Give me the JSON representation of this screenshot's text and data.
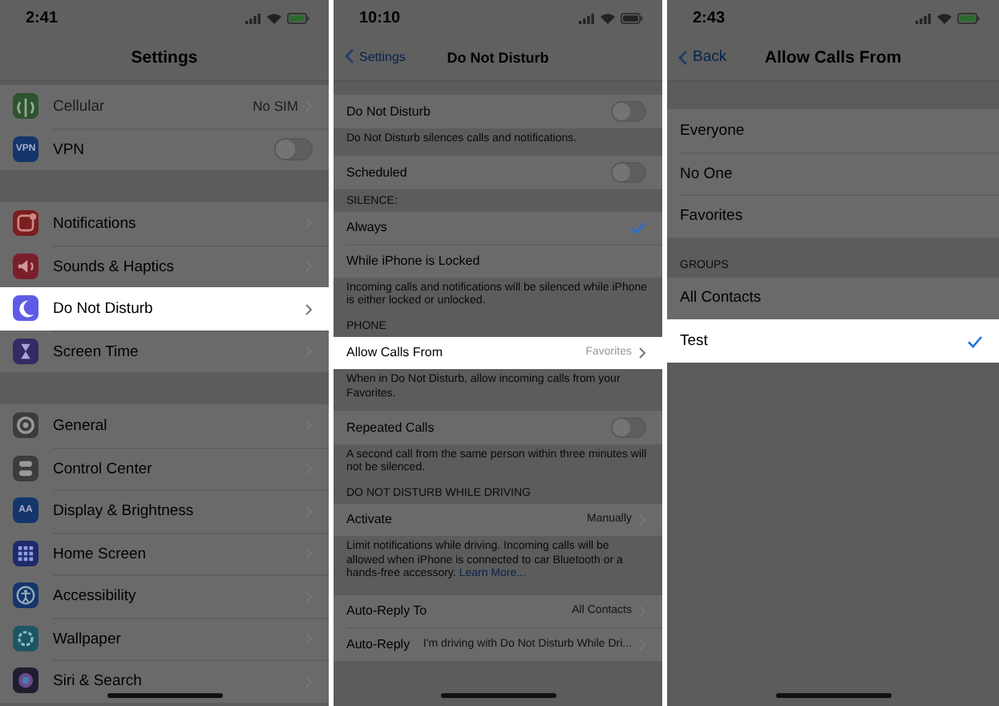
{
  "panels": [
    {
      "status": {
        "time": "2:41"
      },
      "nav": {
        "title": "Settings"
      },
      "sections": [
        {
          "rows": [
            {
              "label": "Cellular",
              "value": "No SIM",
              "chevron": true,
              "disabled": true,
              "selected": false,
              "icon": {
                "kind": "antenna",
                "color": "#2f5230"
              }
            },
            {
              "label": "VPN",
              "toggle": {
                "on": false
              },
              "disabled": false,
              "selected": false,
              "icon": {
                "kind": "text",
                "text": "VPN",
                "color": "#14366b"
              }
            }
          ]
        },
        {
          "rows": [
            {
              "label": "Notifications",
              "chevron": true,
              "disabled": false,
              "selected": false,
              "icon": {
                "kind": "bell",
                "color": "#7a1e1e"
              }
            },
            {
              "label": "Sounds & Haptics",
              "chevron": true,
              "disabled": false,
              "selected": false,
              "icon": {
                "kind": "speaker",
                "color": "#7a1e2a"
              }
            },
            {
              "label": "Do Not Disturb",
              "chevron": true,
              "disabled": false,
              "selected": true,
              "icon": {
                "kind": "moon",
                "color": "#5e5ce6"
              }
            },
            {
              "label": "Screen Time",
              "chevron": true,
              "disabled": false,
              "selected": false,
              "icon": {
                "kind": "hourglass",
                "color": "#332a66"
              }
            }
          ]
        },
        {
          "rows": [
            {
              "label": "General",
              "chevron": true,
              "disabled": false,
              "selected": false,
              "icon": {
                "kind": "gear",
                "color": "#3c3c3c"
              }
            },
            {
              "label": "Control Center",
              "chevron": true,
              "disabled": false,
              "selected": false,
              "icon": {
                "kind": "switches",
                "color": "#3c3c3c"
              }
            },
            {
              "label": "Display & Brightness",
              "chevron": true,
              "disabled": false,
              "selected": false,
              "icon": {
                "kind": "text",
                "text": "AA",
                "color": "#14366b"
              }
            },
            {
              "label": "Home Screen",
              "chevron": true,
              "disabled": false,
              "selected": false,
              "icon": {
                "kind": "grid",
                "color": "#1e2a6b"
              }
            },
            {
              "label": "Accessibility",
              "chevron": true,
              "disabled": false,
              "selected": false,
              "icon": {
                "kind": "person",
                "color": "#14366b"
              }
            },
            {
              "label": "Wallpaper",
              "chevron": true,
              "disabled": false,
              "selected": false,
              "icon": {
                "kind": "flower",
                "color": "#1e5563"
              }
            },
            {
              "label": "Siri & Search",
              "chevron": true,
              "disabled": false,
              "selected": false,
              "icon": {
                "kind": "orb",
                "color": "#1e1e2e"
              }
            }
          ]
        }
      ]
    },
    {
      "status": {
        "time": "10:10"
      },
      "nav": {
        "back": "Settings",
        "title": "Do Not Disturb"
      },
      "sections": [
        {
          "rows": [
            {
              "label": "Do Not Disturb",
              "toggle": {
                "on": false
              },
              "selected": false
            }
          ],
          "footer": "Do Not Disturb silences calls and notifications."
        },
        {
          "rows": [
            {
              "label": "Scheduled",
              "toggle": {
                "on": false
              },
              "selected": false
            }
          ]
        },
        {
          "header": "SILENCE:",
          "rows": [
            {
              "label": "Always",
              "checked": true,
              "selected": false
            },
            {
              "label": "While iPhone is Locked",
              "checked": false,
              "selected": false
            }
          ],
          "footer": "Incoming calls and notifications will be silenced while iPhone is either locked or unlocked."
        },
        {
          "header": "PHONE",
          "rows": [
            {
              "label": "Allow Calls From",
              "value": "Favorites",
              "chevron": true,
              "selected": true
            }
          ],
          "footer": "When in Do Not Disturb, allow incoming calls from your Favorites."
        },
        {
          "rows": [
            {
              "label": "Repeated Calls",
              "toggle": {
                "on": false
              },
              "selected": false
            }
          ],
          "footer": "A second call from the same person within three minutes will not be silenced."
        },
        {
          "header": "DO NOT DISTURB WHILE DRIVING",
          "rows": [
            {
              "label": "Activate",
              "value": "Manually",
              "chevron": true,
              "selected": false
            }
          ],
          "footer": "Limit notifications while driving. Incoming calls will be allowed when iPhone is connected to car Bluetooth or a hands-free accessory.",
          "footer_link": "Learn More..."
        },
        {
          "rows": [
            {
              "label": "Auto-Reply To",
              "value": "All Contacts",
              "chevron": true,
              "selected": false
            },
            {
              "label": "Auto-Reply",
              "value": "I'm driving with Do Not Disturb While Dri...",
              "chevron": true,
              "selected": false
            }
          ]
        }
      ]
    },
    {
      "status": {
        "time": "2:43"
      },
      "nav": {
        "back": "Back",
        "title": "Allow Calls From"
      },
      "sections": [
        {
          "rows": [
            {
              "label": "Everyone",
              "checked": false,
              "selected": false
            },
            {
              "label": "No One",
              "checked": false,
              "selected": false
            },
            {
              "label": "Favorites",
              "checked": false,
              "selected": false
            }
          ]
        },
        {
          "header": "GROUPS",
          "rows": [
            {
              "label": "All Contacts",
              "checked": false,
              "selected": false
            },
            {
              "label": "Test",
              "checked": true,
              "selected": true
            }
          ]
        }
      ]
    }
  ]
}
